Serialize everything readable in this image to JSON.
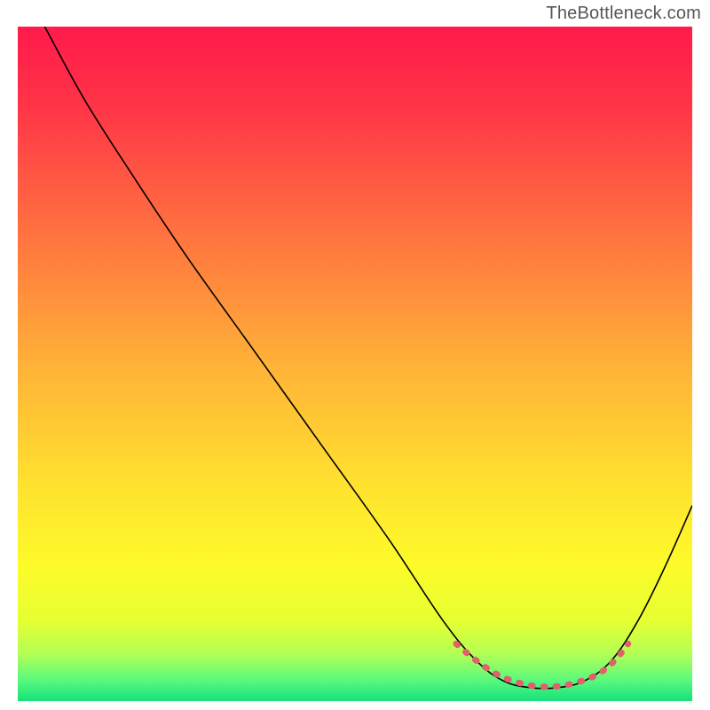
{
  "attribution": "TheBottleneck.com",
  "chart_data": {
    "type": "line",
    "x_range": [
      0,
      100
    ],
    "y_range": [
      0,
      100
    ],
    "title": "",
    "xlabel": "",
    "ylabel": "",
    "background_gradient": {
      "stops": [
        {
          "offset": 0.0,
          "color": "#ff1a4b"
        },
        {
          "offset": 0.12,
          "color": "#ff3547"
        },
        {
          "offset": 0.3,
          "color": "#ff7040"
        },
        {
          "offset": 0.5,
          "color": "#ffb138"
        },
        {
          "offset": 0.68,
          "color": "#ffe22f"
        },
        {
          "offset": 0.8,
          "color": "#fdfb2a"
        },
        {
          "offset": 0.88,
          "color": "#e6ff31"
        },
        {
          "offset": 0.93,
          "color": "#b3ff55"
        },
        {
          "offset": 0.97,
          "color": "#57f97e"
        },
        {
          "offset": 1.0,
          "color": "#16e07a"
        }
      ]
    },
    "series": [
      {
        "name": "bottleneck-curve",
        "color": "#000000",
        "width": 1.6,
        "points": [
          {
            "x": 4.0,
            "y": 100.0
          },
          {
            "x": 10.0,
            "y": 89.0
          },
          {
            "x": 17.0,
            "y": 78.0
          },
          {
            "x": 25.0,
            "y": 66.0
          },
          {
            "x": 35.0,
            "y": 52.0
          },
          {
            "x": 45.0,
            "y": 38.0
          },
          {
            "x": 55.0,
            "y": 24.0
          },
          {
            "x": 63.0,
            "y": 12.0
          },
          {
            "x": 68.0,
            "y": 6.0
          },
          {
            "x": 72.0,
            "y": 3.0
          },
          {
            "x": 76.0,
            "y": 2.0
          },
          {
            "x": 80.0,
            "y": 2.0
          },
          {
            "x": 84.0,
            "y": 3.0
          },
          {
            "x": 88.0,
            "y": 6.0
          },
          {
            "x": 92.0,
            "y": 12.0
          },
          {
            "x": 96.0,
            "y": 20.0
          },
          {
            "x": 100.0,
            "y": 29.0
          }
        ]
      },
      {
        "name": "optimal-zone-marker",
        "color": "#e0606b",
        "width": 7,
        "dash": [
          2,
          12
        ],
        "linecap": "round",
        "points": [
          {
            "x": 65.0,
            "y": 8.5
          },
          {
            "x": 68.0,
            "y": 6.0
          },
          {
            "x": 71.0,
            "y": 4.0
          },
          {
            "x": 74.0,
            "y": 2.8
          },
          {
            "x": 77.0,
            "y": 2.2
          },
          {
            "x": 80.0,
            "y": 2.2
          },
          {
            "x": 83.0,
            "y": 2.8
          },
          {
            "x": 86.0,
            "y": 4.0
          },
          {
            "x": 88.5,
            "y": 6.0
          },
          {
            "x": 90.5,
            "y": 8.5
          }
        ]
      }
    ]
  }
}
